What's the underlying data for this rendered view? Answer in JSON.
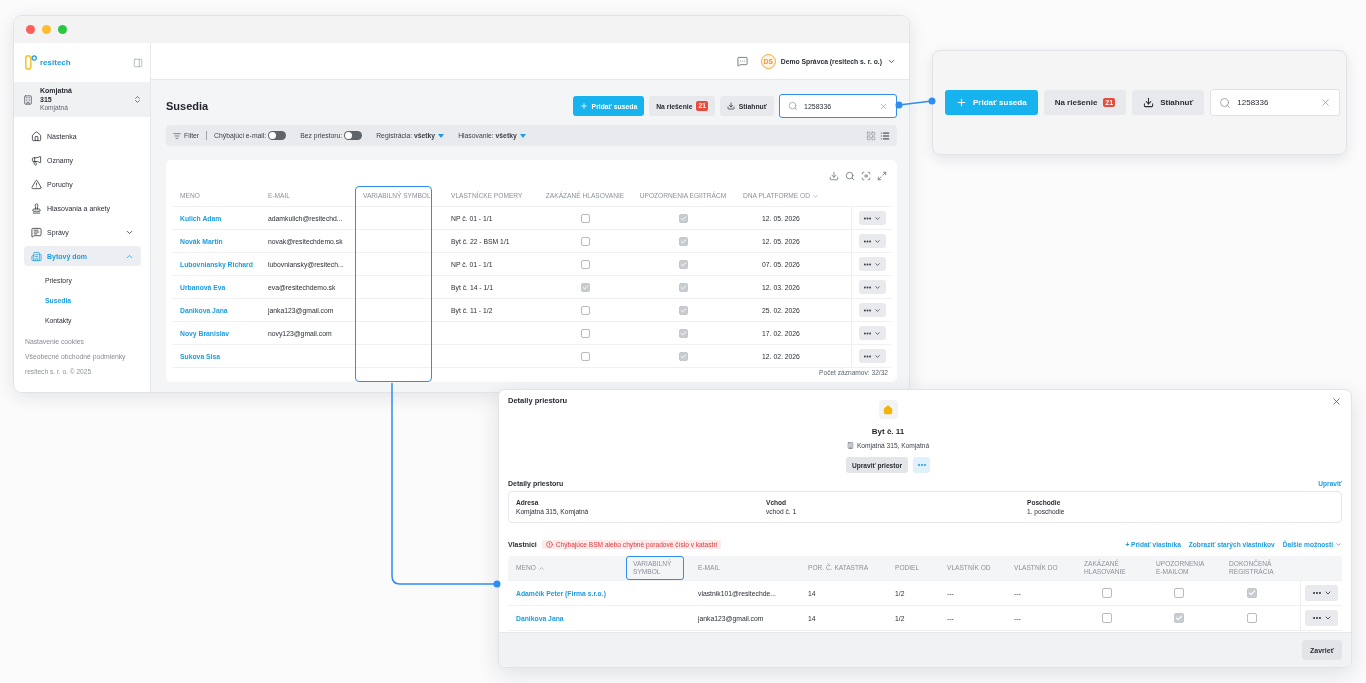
{
  "app_window": {
    "sidebar": {
      "logo": "resitech",
      "building": {
        "name": "Komjatná 315",
        "city": "Komjatná"
      },
      "nav": [
        {
          "label": "Nástenka",
          "selected": false
        },
        {
          "label": "Oznamy",
          "selected": false
        },
        {
          "label": "Poruchy",
          "selected": false
        },
        {
          "label": "Hlasovania a ankety",
          "selected": false
        },
        {
          "label": "Správy",
          "selected": false,
          "expanded": false
        },
        {
          "label": "Bytový dom",
          "selected": true,
          "expanded": true,
          "children": [
            {
              "label": "Priestory",
              "selected": false
            },
            {
              "label": "Susedia",
              "selected": true
            },
            {
              "label": "Kontakty",
              "selected": false
            }
          ]
        }
      ],
      "footer_links": [
        "Nastavenie cookies",
        "Všeobecné obchodné podmienky"
      ],
      "copyright": "resitech s. r. o. © 2025"
    },
    "top_bar": {
      "user": {
        "initials": "DS",
        "name": "Demo Správca (resitech s. r. o.)"
      }
    },
    "page": {
      "title": "Susedia",
      "add_button": "Pridať suseda",
      "pending_button": {
        "label": "Na riešenie",
        "count": "21"
      },
      "download_button": "Stiahnuť",
      "search": {
        "value": "1258336",
        "highlighted": true
      }
    },
    "filters": {
      "label": "Filter",
      "toggles": [
        {
          "label": "Chýbajúci e-mail:",
          "on": false
        },
        {
          "label": "Bez priestoru:",
          "on": false
        }
      ],
      "dropdowns": [
        {
          "label": "Registrácia:",
          "value": "všetky"
        },
        {
          "label": "Hlasovanie:",
          "value": "všetky"
        }
      ],
      "views": [
        {
          "kind": "grid",
          "selected": false
        },
        {
          "kind": "list",
          "selected": true
        }
      ]
    },
    "table": {
      "columns": [
        {
          "label": "MENO",
          "highlighted": false,
          "sorted": false
        },
        {
          "label": "E-MAIL",
          "highlighted": false,
          "sorted": false
        },
        {
          "label": "VARIABILNÝ SYMBOL",
          "highlighted": true,
          "sorted": false
        },
        {
          "label": "VLASTNÍCKE POMERY",
          "highlighted": false,
          "sorted": false
        },
        {
          "label": "ZAKÁZANÉ HLASOVANIE",
          "highlighted": false,
          "sorted": false
        },
        {
          "label": "UPOZORNENIA EGIITRÁCM",
          "highlighted": false,
          "sorted": false
        },
        {
          "label": "DNA PLATFORME OD",
          "highlighted": false,
          "sorted": true,
          "descending": true
        }
      ],
      "rows": [
        {
          "name": "Kulich Adam",
          "email": "adamkulich@resitechd...",
          "ownership": "NP č. 01 - 1/1",
          "voting_disabled": false,
          "email_notifications": true,
          "joined": "12. 05. 2026"
        },
        {
          "name": "Novák Martin",
          "email": "novak@resitechdemo.sk",
          "ownership": "Byt č. 22 - BSM 1/1",
          "voting_disabled": false,
          "email_notifications": true,
          "joined": "12. 05. 2026"
        },
        {
          "name": "Lubovniansky Richard",
          "email": "lubovniansky@resitech...",
          "ownership": "NP č. 01 - 1/1",
          "voting_disabled": false,
          "email_notifications": true,
          "joined": "07. 05. 2026"
        },
        {
          "name": "Urbanová Eva",
          "email": "eva@resitechdemo.sk",
          "ownership": "Byt č. 14 - 1/1",
          "voting_disabled": true,
          "email_notifications": true,
          "joined": "12. 03. 2026"
        },
        {
          "name": "Danikova Jana",
          "email": "janka123@gmail.com",
          "ownership": "Byt č. 11 - 1/2",
          "voting_disabled": false,
          "email_notifications": true,
          "joined": "25. 02. 2026"
        },
        {
          "name": "Novy Branislav",
          "email": "novy123@gmail.com",
          "voting_disabled": false,
          "email_notifications": true,
          "joined": "17. 02. 2026"
        },
        {
          "name": "Sukova Sisa",
          "voting_disabled": false,
          "email_notifications": true,
          "joined": "12. 02. 2026"
        }
      ],
      "record_count": "Počet záznamov: 32/32"
    }
  },
  "callout": {
    "add_button": "Pridať suseda",
    "pending_button": {
      "label": "Na riešenie",
      "count": "21"
    },
    "download_button": "Stiahnuť",
    "search": {
      "value": "1258336",
      "highlighted": false
    }
  },
  "dialog": {
    "title": "Detaily priestoru",
    "unit": {
      "name": "Byt č. 11",
      "address": "Komjatná 315, Komjatná",
      "edit_button": "Upraviť priestor"
    },
    "details": {
      "heading": "Detaily priestoru",
      "edit_link": "Upraviť",
      "fields": [
        {
          "label": "Adresa",
          "value": "Komjatná 315, Komjatná"
        },
        {
          "label": "Vchod",
          "value": "vchod č. 1"
        },
        {
          "label": "Poschodie",
          "value": "1. poschodie"
        }
      ]
    },
    "owners": {
      "heading": "Vlastníci",
      "warning": "Chýbajúce BSM alebo chybné poradové číslo v katastri",
      "actions": [
        {
          "label": "+ Pridať vlastníka",
          "kind": "link"
        },
        {
          "label": "Zobraziť starých vlastníkov",
          "kind": "link"
        },
        {
          "label": "Ďalšie možnosti",
          "kind": "menu"
        }
      ],
      "columns": [
        {
          "label": "MENO",
          "highlighted": false,
          "sorted": true,
          "descending": false
        },
        {
          "label": "VARIABILNÝ SYMBOL",
          "highlighted": true,
          "sorted": false
        },
        {
          "label": "E-MAIL",
          "highlighted": false,
          "sorted": false
        },
        {
          "label": "POR. Č. KATASTRA",
          "highlighted": false,
          "sorted": false
        },
        {
          "label": "PODIEL",
          "highlighted": false,
          "sorted": false
        },
        {
          "label": "VLASTNÍK OD",
          "highlighted": false,
          "sorted": false
        },
        {
          "label": "VLASTNÍK DO",
          "highlighted": false,
          "sorted": false
        },
        {
          "label": "ZAKÁZANÉ HLASOVANIE",
          "highlighted": false,
          "sorted": false
        },
        {
          "label": "UPOZORNENIA E-MAILOM",
          "highlighted": false,
          "sorted": false
        },
        {
          "label": "DOKONČENÁ REGISTRÁCIA",
          "highlighted": false,
          "sorted": false
        }
      ],
      "rows": [
        {
          "name": "Adamčík Peter (Firma s.r.o.)",
          "email": "vlastnik101@resitechde...",
          "cadastre_number": "14",
          "share": "1/2",
          "owner_from": "---",
          "owner_to": "---",
          "voting_disabled": false,
          "email_notifications": false,
          "registration_completed": true
        },
        {
          "name": "Danikova Jana",
          "email": "janka123@gmail.com",
          "cadastre_number": "14",
          "share": "1/2",
          "owner_from": "---",
          "owner_to": "---",
          "voting_disabled": false,
          "email_notifications": true,
          "registration_completed": false
        }
      ]
    },
    "close_button": "Zavrieť"
  }
}
